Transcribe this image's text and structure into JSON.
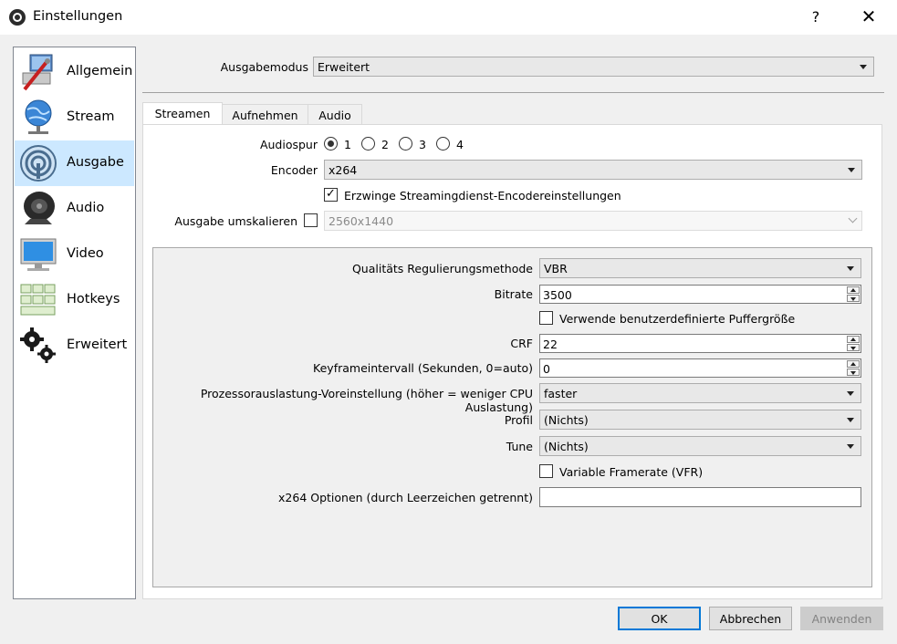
{
  "window": {
    "title": "Einstellungen",
    "help": "?",
    "close": "✕"
  },
  "sidebar": {
    "items": [
      {
        "label": "Allgemein",
        "icon": "tools-icon"
      },
      {
        "label": "Stream",
        "icon": "globe-icon"
      },
      {
        "label": "Ausgabe",
        "icon": "broadcast-icon",
        "selected": true
      },
      {
        "label": "Audio",
        "icon": "speaker-icon"
      },
      {
        "label": "Video",
        "icon": "monitor-icon"
      },
      {
        "label": "Hotkeys",
        "icon": "keyboard-icon"
      },
      {
        "label": "Erweitert",
        "icon": "gears-icon"
      }
    ]
  },
  "output_mode": {
    "label": "Ausgabemodus",
    "value": "Erweitert"
  },
  "tabs": [
    {
      "label": "Streamen",
      "active": true
    },
    {
      "label": "Aufnehmen"
    },
    {
      "label": "Audio"
    }
  ],
  "streaming": {
    "audio_track": {
      "label": "Audiospur",
      "options": [
        "1",
        "2",
        "3",
        "4"
      ],
      "selected": "1"
    },
    "encoder": {
      "label": "Encoder",
      "value": "x264"
    },
    "enforce": {
      "label": "Erzwinge Streamingdienst-Encodereinstellungen",
      "checked": true,
      "mark": "✓"
    },
    "rescale": {
      "label": "Ausgabe umskalieren",
      "checked": false,
      "value": "2560x1440"
    }
  },
  "encoder_settings": {
    "rate_control": {
      "label": "Qualitäts Regulierungsmethode",
      "value": "VBR"
    },
    "bitrate": {
      "label": "Bitrate",
      "value": "3500"
    },
    "custom_buffer": {
      "label": "Verwende benutzerdefinierte Puffergröße",
      "checked": false
    },
    "crf": {
      "label": "CRF",
      "value": "22"
    },
    "keyframe": {
      "label": "Keyframeintervall (Sekunden, 0=auto)",
      "value": "0"
    },
    "preset": {
      "label": "Prozessorauslastung-Voreinstellung (höher = weniger CPU Auslastung)",
      "value": "faster"
    },
    "profile": {
      "label": "Profil",
      "value": "(Nichts)"
    },
    "tune": {
      "label": "Tune",
      "value": "(Nichts)"
    },
    "vfr": {
      "label": "Variable Framerate (VFR)",
      "checked": false
    },
    "x264opts": {
      "label": "x264 Optionen (durch Leerzeichen getrennt)",
      "value": ""
    }
  },
  "buttons": {
    "ok": "OK",
    "cancel": "Abbrechen",
    "apply": "Anwenden"
  },
  "colors": {
    "selection": "#cce8ff",
    "accent": "#0078d7"
  }
}
